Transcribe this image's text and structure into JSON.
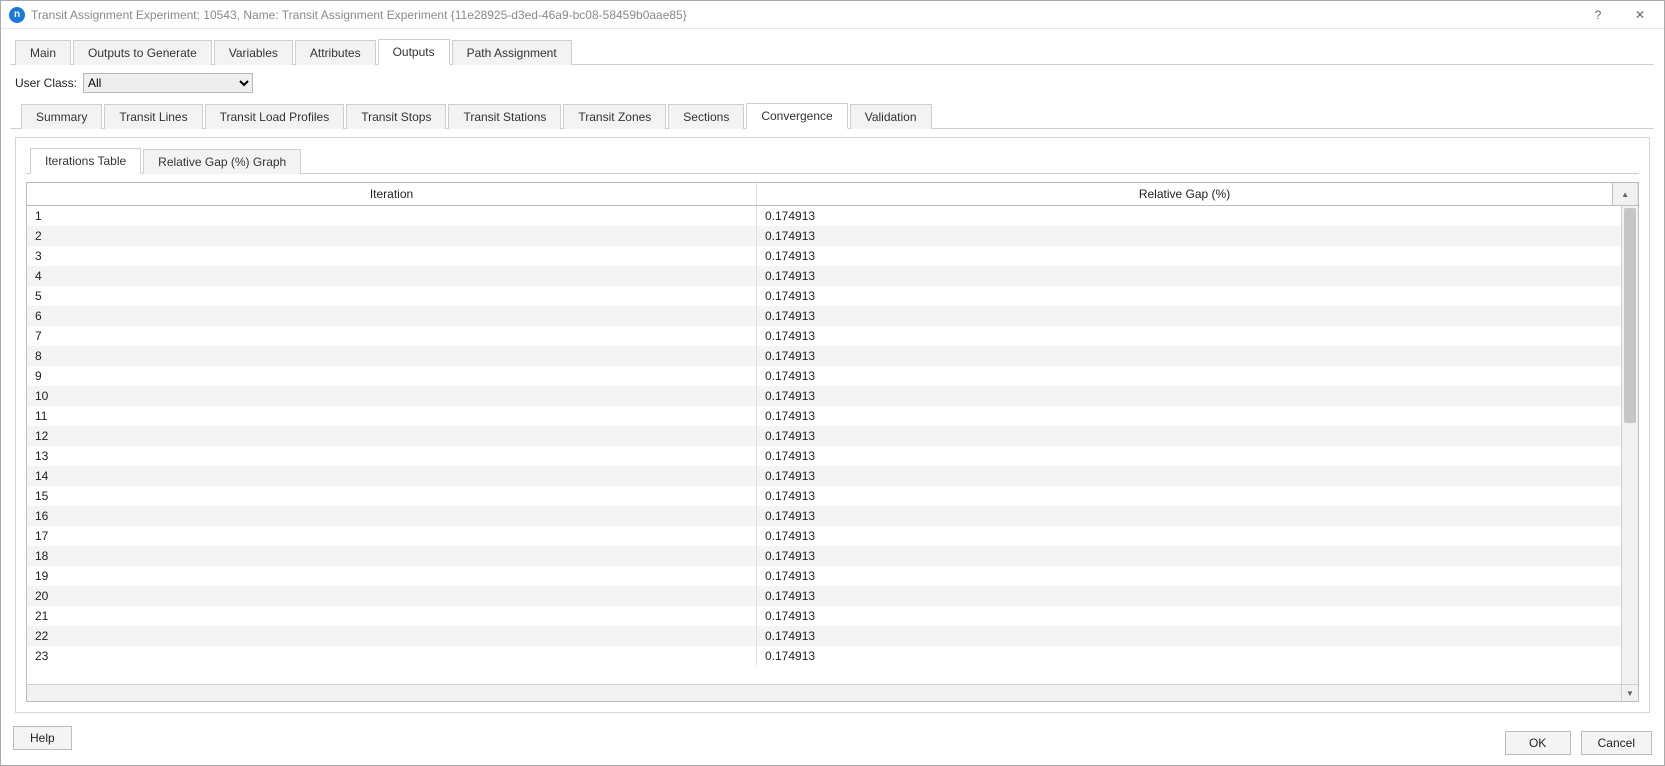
{
  "window": {
    "title": "Transit Assignment Experiment: 10543, Name: Transit Assignment Experiment {11e28925-d3ed-46a9-bc08-58459b0aae85}",
    "help_symbol": "?",
    "close_symbol": "✕"
  },
  "top_tabs": {
    "items": [
      {
        "label": "Main"
      },
      {
        "label": "Outputs to Generate"
      },
      {
        "label": "Variables"
      },
      {
        "label": "Attributes"
      },
      {
        "label": "Outputs",
        "active": true
      },
      {
        "label": "Path Assignment"
      }
    ]
  },
  "user_class": {
    "label": "User Class:",
    "value": "All",
    "options": [
      "All"
    ]
  },
  "sub_tabs": {
    "items": [
      {
        "label": "Summary"
      },
      {
        "label": "Transit Lines"
      },
      {
        "label": "Transit Load Profiles"
      },
      {
        "label": "Transit Stops"
      },
      {
        "label": "Transit Stations"
      },
      {
        "label": "Transit Zones"
      },
      {
        "label": "Sections"
      },
      {
        "label": "Convergence",
        "active": true
      },
      {
        "label": "Validation"
      }
    ]
  },
  "inner_tabs": {
    "items": [
      {
        "label": "Iterations Table",
        "active": true
      },
      {
        "label": "Relative Gap (%) Graph"
      }
    ]
  },
  "table": {
    "columns": {
      "iteration": "Iteration",
      "gap": "Relative Gap (%)"
    },
    "rows": [
      {
        "iteration": "1",
        "gap": "0.174913"
      },
      {
        "iteration": "2",
        "gap": "0.174913"
      },
      {
        "iteration": "3",
        "gap": "0.174913"
      },
      {
        "iteration": "4",
        "gap": "0.174913"
      },
      {
        "iteration": "5",
        "gap": "0.174913"
      },
      {
        "iteration": "6",
        "gap": "0.174913"
      },
      {
        "iteration": "7",
        "gap": "0.174913"
      },
      {
        "iteration": "8",
        "gap": "0.174913"
      },
      {
        "iteration": "9",
        "gap": "0.174913"
      },
      {
        "iteration": "10",
        "gap": "0.174913"
      },
      {
        "iteration": "11",
        "gap": "0.174913"
      },
      {
        "iteration": "12",
        "gap": "0.174913"
      },
      {
        "iteration": "13",
        "gap": "0.174913"
      },
      {
        "iteration": "14",
        "gap": "0.174913"
      },
      {
        "iteration": "15",
        "gap": "0.174913"
      },
      {
        "iteration": "16",
        "gap": "0.174913"
      },
      {
        "iteration": "17",
        "gap": "0.174913"
      },
      {
        "iteration": "18",
        "gap": "0.174913"
      },
      {
        "iteration": "19",
        "gap": "0.174913"
      },
      {
        "iteration": "20",
        "gap": "0.174913"
      },
      {
        "iteration": "21",
        "gap": "0.174913"
      },
      {
        "iteration": "22",
        "gap": "0.174913"
      },
      {
        "iteration": "23",
        "gap": "0.174913"
      }
    ]
  },
  "footer": {
    "help": "Help",
    "ok": "OK",
    "cancel": "Cancel"
  }
}
